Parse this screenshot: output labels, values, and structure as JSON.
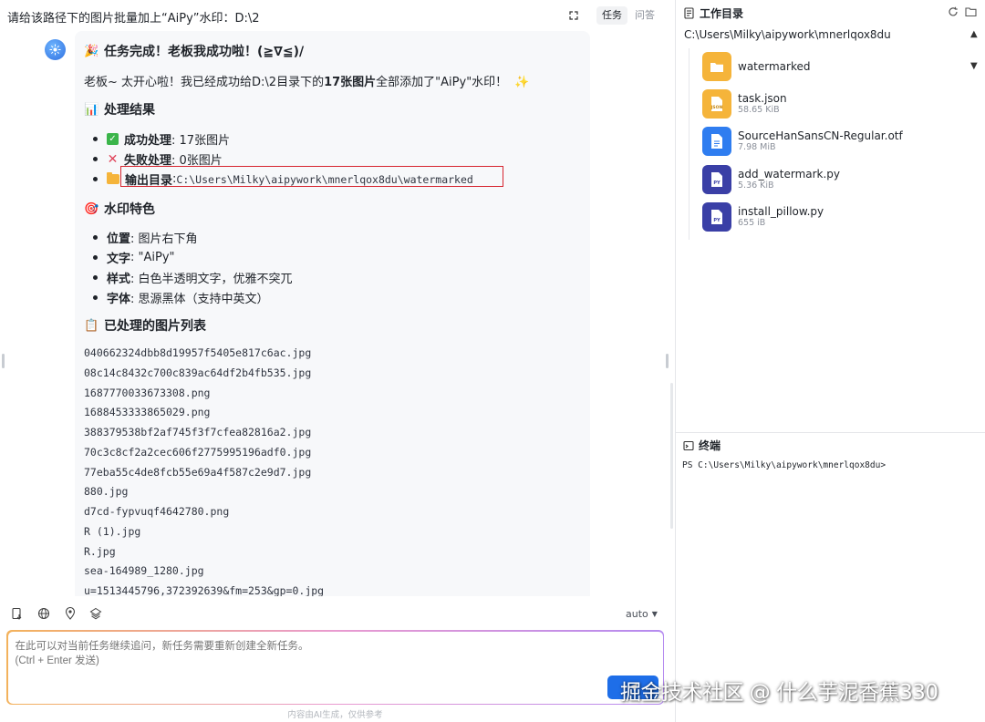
{
  "header": {
    "title": "请给该路径下的图片批量加上“AiPy”水印：D:\\2",
    "tabs": [
      {
        "label": "任务",
        "active": true
      },
      {
        "label": "问答",
        "active": false
      }
    ]
  },
  "message": {
    "heading": "任务完成！老板我成功啦！(≧∇≦)/",
    "intro_prefix": "老板~ 太开心啦！我已经成功给D:\\2目录下的",
    "intro_bold": "17张图片",
    "intro_suffix": "全部添加了\"AiPy\"水印！",
    "section_results": {
      "title": "处理结果",
      "items": [
        {
          "label": "成功处理",
          "value": ": 17张图片"
        },
        {
          "label": "失败处理",
          "value": ": 0张图片"
        },
        {
          "label": "输出目录",
          "value": ": ",
          "code": "C:\\Users\\Milky\\aipywork\\mnerlqox8du\\watermarked"
        }
      ]
    },
    "section_features": {
      "title": "水印特色",
      "items": [
        {
          "label": "位置",
          "value": ": 图片右下角"
        },
        {
          "label": "文字",
          "value": ": \"AiPy\""
        },
        {
          "label": "样式",
          "value": ": 白色半透明文字，优雅不突兀"
        },
        {
          "label": "字体",
          "value": ": 思源黑体（支持中英文）"
        }
      ]
    },
    "section_files": {
      "title": "已处理的图片列表",
      "files": [
        "040662324dbb8d19957f5405e817c6ac.jpg",
        "08c14c8432c700c839ac64df2b4fb535.jpg",
        "1687770033673308.png",
        "1688453333865029.png",
        "388379538bf2af745f3f7cfea82816a2.jpg",
        "70c3c8cf2a2cec606f2775995196adf0.jpg",
        "77eba55c4de8fcb55e69a4f587c2e9d7.jpg",
        "880.jpg",
        "d7cd-fypvuqf4642780.png",
        "R (1).jpg",
        "R.jpg",
        "sea-164989_1280.jpg",
        "u=1513445796,372392639&fm=253&gp=0.jpg"
      ]
    }
  },
  "toolbar": {
    "model_select": "auto"
  },
  "input": {
    "placeholder": "在此可以对当前任务继续追问，新任务需要重新创建全新任务。\n(Ctrl + Enter 发送)"
  },
  "disclaimer": "内容由AI生成，仅供参考",
  "overlay_watermark": "掘金技术社区 @ 什么芋泥香蕉330",
  "workdir": {
    "title": "工作目录",
    "path": "C:\\Users\\Milky\\aipywork\\mnerlqox8du",
    "items": [
      {
        "name": "watermarked",
        "size": "",
        "kind": "folder"
      },
      {
        "name": "task.json",
        "size": "58.65 KiB",
        "kind": "json"
      },
      {
        "name": "SourceHanSansCN-Regular.otf",
        "size": "7.98 MiB",
        "kind": "file"
      },
      {
        "name": "add_watermark.py",
        "size": "5.36 KiB",
        "kind": "py"
      },
      {
        "name": "install_pillow.py",
        "size": "655 iB",
        "kind": "py"
      }
    ]
  },
  "terminal": {
    "title": "终端",
    "prompt": "PS C:\\Users\\Milky\\aipywork\\mnerlqox8du>"
  },
  "colors": {
    "accent": "#1e6ee8",
    "folder": "#f5b43a",
    "python": "#3a3fa6",
    "highlight_box": "#d6252f"
  }
}
